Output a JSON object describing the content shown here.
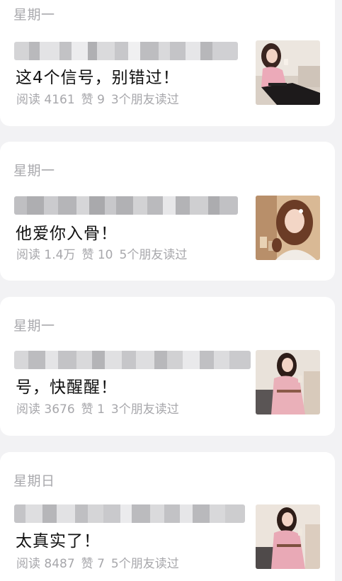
{
  "articles": [
    {
      "day": "星期一",
      "title": "这4个信号，别错过！",
      "reads": "阅读 4161",
      "likes": "赞 9",
      "friends": "3个朋友读过",
      "thumbnail": "woman-pink-blouse-sofa-thumbnail"
    },
    {
      "day": "星期一",
      "title": "他爱你入骨！",
      "reads": "阅读 1.4万",
      "likes": "赞 10",
      "friends": "5个朋友读过",
      "thumbnail": "woman-wavy-hair-portrait-thumbnail"
    },
    {
      "day": "星期一",
      "title": "号，快醒醒！",
      "reads": "阅读 3676",
      "likes": "赞 1",
      "friends": "3个朋友读过",
      "thumbnail": "woman-pink-dress-seated-thumbnail"
    },
    {
      "day": "星期日",
      "title": "太真实了！",
      "reads": "阅读 8487",
      "likes": "赞 7",
      "friends": "5个朋友读过",
      "thumbnail": "woman-pink-dress-seated-thumbnail"
    }
  ]
}
